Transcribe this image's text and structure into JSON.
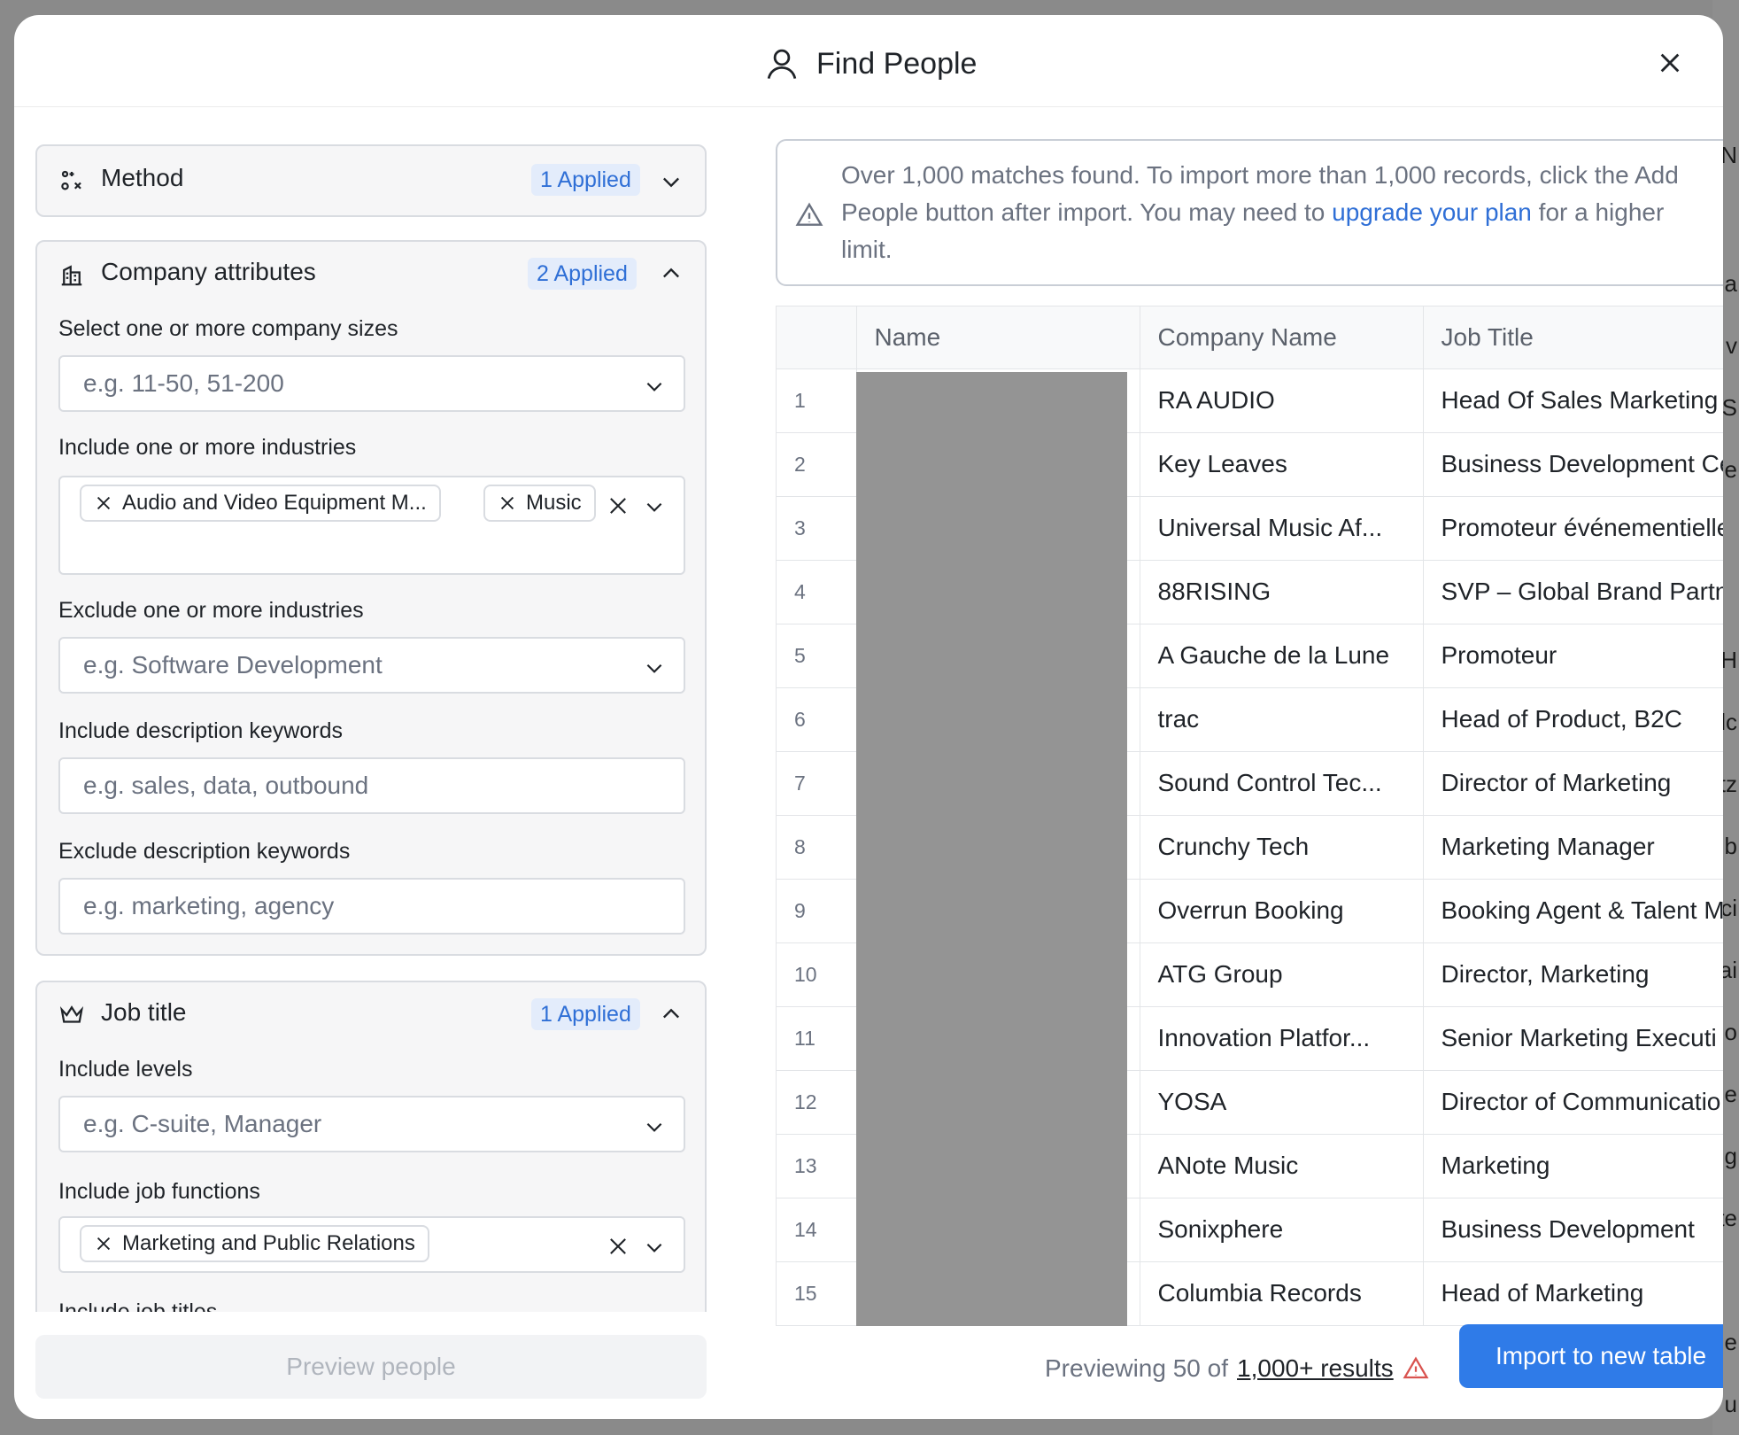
{
  "modal": {
    "title": "Find People"
  },
  "method": {
    "title": "Method",
    "badge": "1 Applied"
  },
  "company": {
    "title": "Company attributes",
    "badge": "2 Applied",
    "sizes_label": "Select one or more company sizes",
    "sizes_placeholder": "e.g. 11-50, 51-200",
    "include_industries_label": "Include one or more industries",
    "include_industries_chips": [
      "Audio and Video Equipment M...",
      "Music"
    ],
    "exclude_industries_label": "Exclude one or more industries",
    "exclude_industries_placeholder": "e.g. Software Development",
    "include_keywords_label": "Include description keywords",
    "include_keywords_placeholder": "e.g. sales, data, outbound",
    "exclude_keywords_label": "Exclude description keywords",
    "exclude_keywords_placeholder": "e.g. marketing, agency"
  },
  "job": {
    "title": "Job title",
    "badge": "1 Applied",
    "levels_label": "Include levels",
    "levels_placeholder": "e.g. C-suite, Manager",
    "functions_label": "Include job functions",
    "functions_chips": [
      "Marketing and Public Relations"
    ],
    "titles_label": "Include job titles"
  },
  "preview_button": "Preview people",
  "alert": {
    "text_before": "Over 1,000 matches found. To import more than 1,000 records, click the Add People button after import. You may need to ",
    "link": "upgrade your plan",
    "text_after": " for a higher limit."
  },
  "table": {
    "columns": [
      "",
      "Name",
      "Company Name",
      "Job Title"
    ],
    "rows": [
      {
        "idx": "1",
        "company": "RA AUDIO",
        "title": "Head Of Sales Marketing"
      },
      {
        "idx": "2",
        "company": "Key Leaves",
        "title": "Business Development Ce"
      },
      {
        "idx": "3",
        "company": "Universal Music Af...",
        "title": "Promoteur événementielle"
      },
      {
        "idx": "4",
        "company": "88RISING",
        "title": "SVP – Global Brand Partn"
      },
      {
        "idx": "5",
        "company": "A Gauche de la Lune",
        "title": "Promoteur"
      },
      {
        "idx": "6",
        "company": "trac",
        "title": "Head of Product, B2C"
      },
      {
        "idx": "7",
        "company": "Sound Control Tec...",
        "title": "Director of Marketing"
      },
      {
        "idx": "8",
        "company": "Crunchy Tech",
        "title": "Marketing Manager"
      },
      {
        "idx": "9",
        "company": "Overrun Booking",
        "title": "Booking Agent & Talent M"
      },
      {
        "idx": "10",
        "company": "ATG Group",
        "title": "Director, Marketing"
      },
      {
        "idx": "11",
        "company": "Innovation Platfor...",
        "title": "Senior Marketing Executi"
      },
      {
        "idx": "12",
        "company": "YOSA",
        "title": "Director of Communicatio"
      },
      {
        "idx": "13",
        "company": "ANote Music",
        "title": "Marketing"
      },
      {
        "idx": "14",
        "company": "Sonixphere",
        "title": "Business Development"
      },
      {
        "idx": "15",
        "company": "Columbia Records",
        "title": "Head of Marketing"
      }
    ]
  },
  "footer": {
    "previewing": "Previewing 50 of",
    "results_link": "1,000+ results",
    "import_button": "Import to new table"
  },
  "background_fragments": [
    "N",
    "a",
    "v",
    "S",
    "e",
    "H",
    "lc",
    "tz",
    "b",
    "ci",
    "ai",
    "o",
    "e",
    "g",
    "te",
    "e",
    "u"
  ],
  "colors": {
    "accent": "#2f7be8",
    "badge_bg": "#e3ecfb",
    "badge_text": "#2f6fd6",
    "warning": "#d9534f"
  }
}
